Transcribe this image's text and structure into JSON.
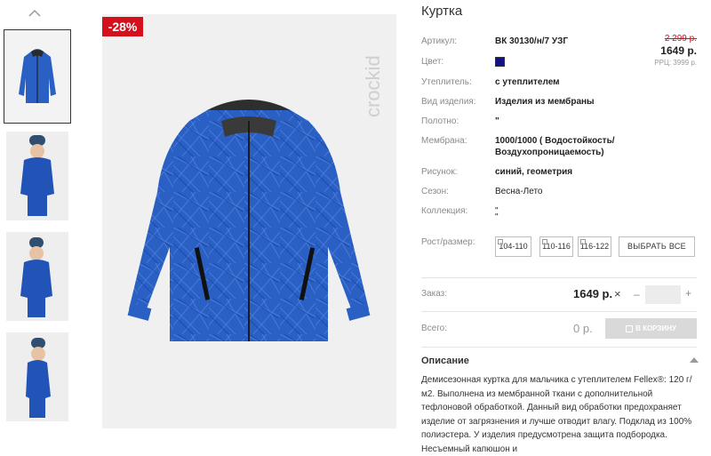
{
  "product": {
    "title": "Куртка",
    "discount_badge": "-28%",
    "brand_logo_text": "crockid"
  },
  "price": {
    "old": "2 299 р.",
    "current": "1649 р.",
    "rrc": "РРЦ: 3999 р."
  },
  "specs": [
    {
      "label": "Артикул:",
      "value": "ВК 30130/н/7 УЗГ",
      "bold": true
    },
    {
      "label": "Цвет:",
      "value": "",
      "bold": false
    },
    {
      "label": "Утеплитель:",
      "value": "с утеплителем",
      "bold": true
    },
    {
      "label": "Вид изделия:",
      "value": "Изделия из мембраны",
      "bold": true
    },
    {
      "label": "Полотно:",
      "value": "\"",
      "bold": true
    },
    {
      "label": "Мембрана:",
      "value": "1000/1000 ( Водостойкость/",
      "value2": "Воздухопроницаемость)",
      "bold": true
    },
    {
      "label": "Рисунок:",
      "value": "синий, геометрия",
      "bold": true
    },
    {
      "label": "Сезон:",
      "value": "Весна-Лето",
      "bold": false
    },
    {
      "label": "Коллекция:",
      "value": "\"",
      "value2": "\"",
      "bold": false
    }
  ],
  "color_swatch": "#14128a",
  "sizes": {
    "label": "Рост/размер:",
    "options": [
      "104-110",
      "110-116",
      "116-122"
    ],
    "select_all": "ВЫБРАТЬ ВСЕ"
  },
  "order": {
    "label": "Заказ:",
    "price": "1649 р.",
    "times": "×",
    "minus": "–",
    "plus": "+",
    "quantity": ""
  },
  "total": {
    "label": "Всего:",
    "value": "0 р.",
    "cart_button": "В КОРЗИНУ"
  },
  "description": {
    "title": "Описание",
    "text": "Демисезонная куртка для мальчика с утеплителем Fellex®: 120 г/м2. Выполнена из мембранной ткани с дополнительной тефлоновой обработкой. Данный вид обработки предохраняет изделие от загрязнения и лучше отводит влагу. Подклад из 100% полиэстера. У изделия предусмотрена защита подбородка. Несъемный капюшон и"
  },
  "colors": {
    "sale_red": "#d5101d",
    "jacket_blue": "#2a5fc4",
    "muted_label": "#8a8a8a"
  }
}
